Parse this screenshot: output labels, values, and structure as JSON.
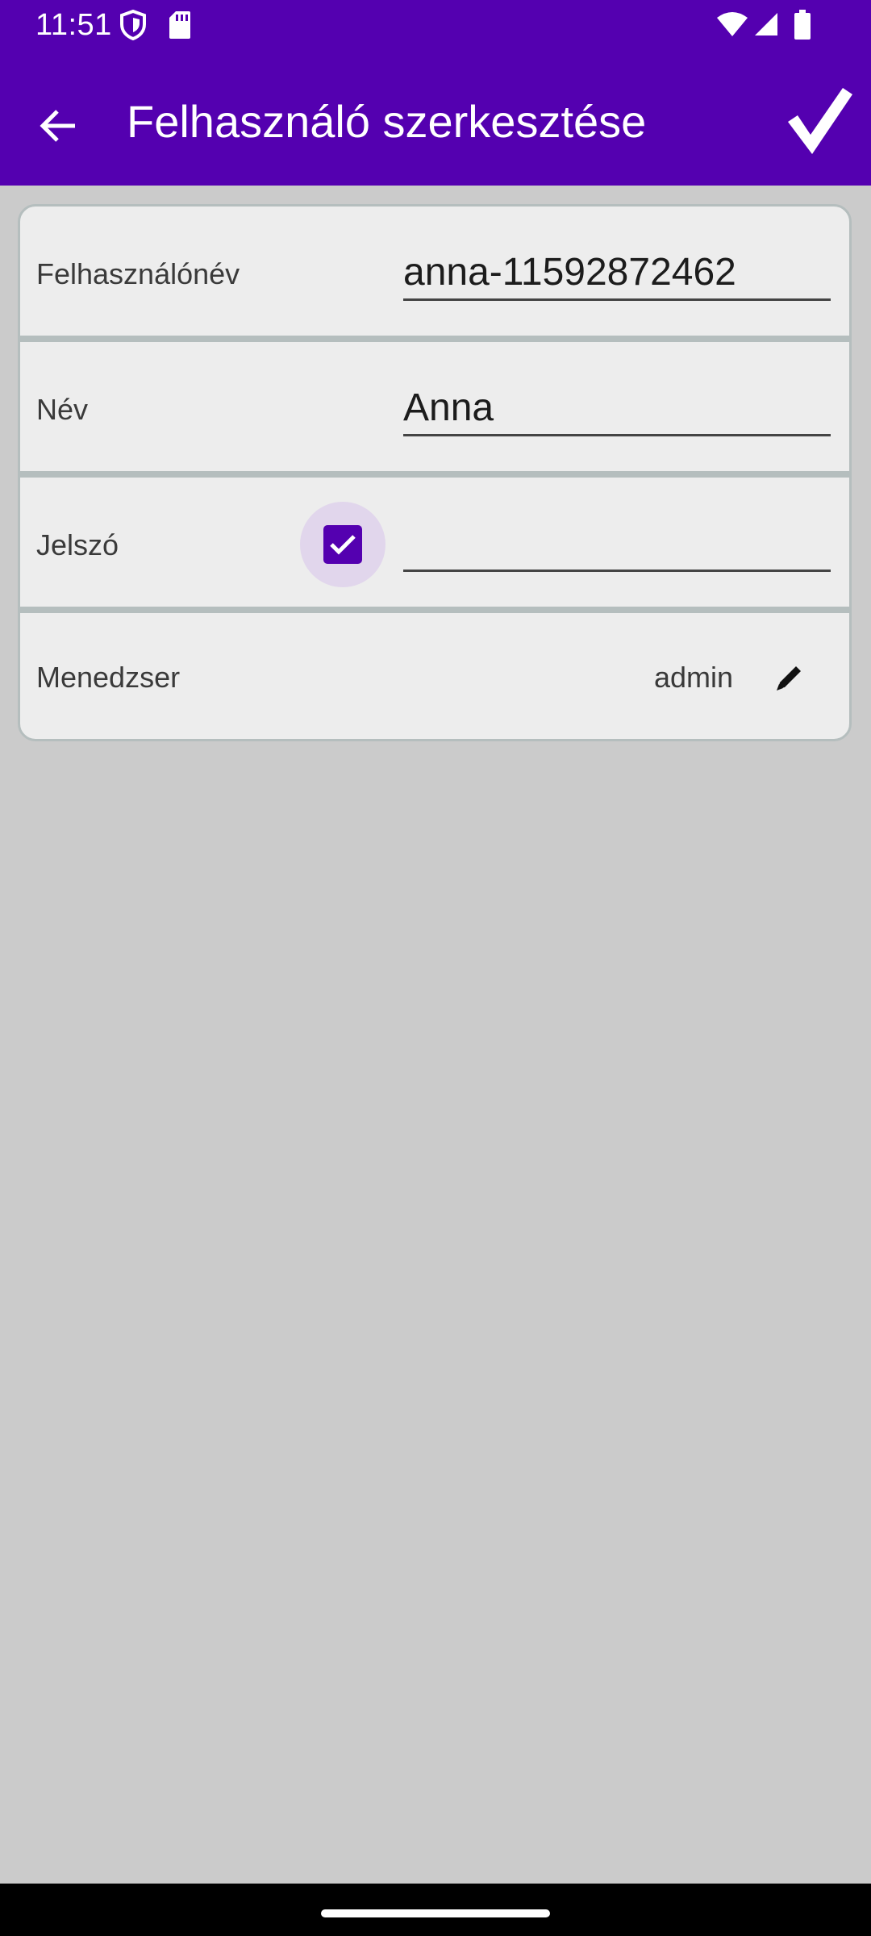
{
  "status_bar": {
    "time": "11:51",
    "icons": [
      "shield-icon",
      "sd-card-icon",
      "wifi-icon",
      "signal-icon",
      "battery-icon"
    ]
  },
  "app_bar": {
    "title": "Felhasználó szerkesztése",
    "back_icon": "arrow-back-icon",
    "save_icon": "checkmark-icon"
  },
  "form": {
    "username": {
      "label": "Felhasználónév",
      "value": "anna-11592872462"
    },
    "name": {
      "label": "Név",
      "value": "Anna"
    },
    "password": {
      "label": "Jelszó",
      "checkbox_checked": true,
      "value": ""
    },
    "manager": {
      "label": "Menedzser",
      "value": "admin",
      "edit_icon": "pencil-icon"
    }
  },
  "colors": {
    "primary": "#5400b0",
    "card_bg": "#ededed",
    "page_bg": "#cbcbcb",
    "divider": "#b5bebe"
  }
}
